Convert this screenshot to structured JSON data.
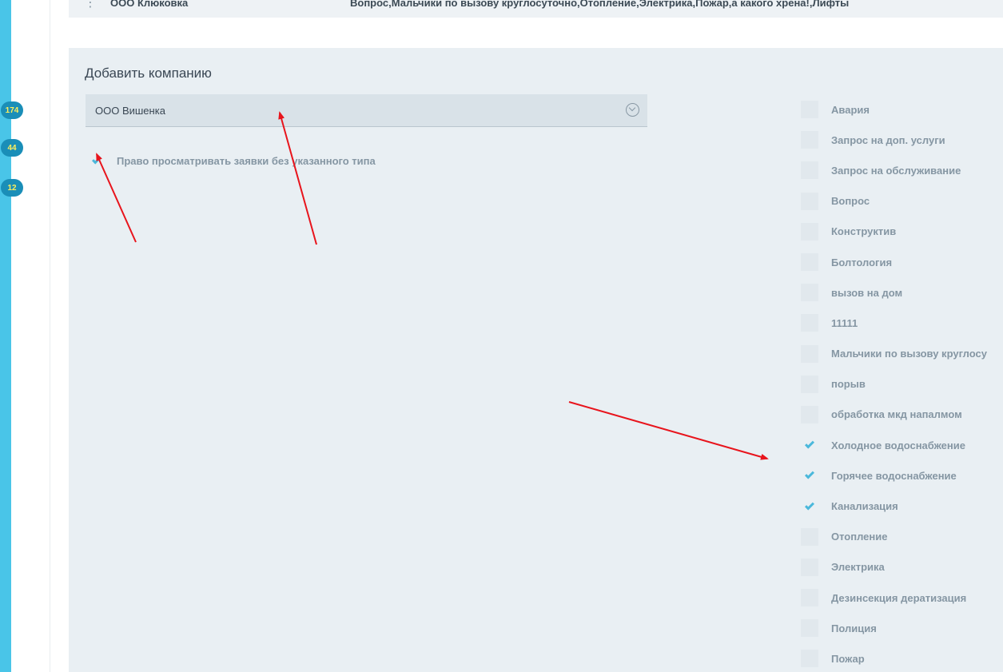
{
  "sidebar": {
    "badges": [
      "174",
      "44",
      "12"
    ],
    "accent_color": "#49c5e8",
    "badge_color": "#1a8eb8",
    "badge_text_color": "#ffef5c"
  },
  "table_row": {
    "company": "ООО Клюковка",
    "types": "Вопрос,Мальчики по вызову круглосуточно,Отопление,Электрика,Пожар,а какого хрена!,Лифты"
  },
  "add_company": {
    "title": "Добавить компанию",
    "select_value": "ООО Вишенка",
    "permission_label": "Право просматривать заявки без указанного типа",
    "permission_checked": true
  },
  "request_types": [
    {
      "label": "Авария",
      "checked": false
    },
    {
      "label": "Запрос на доп. услуги",
      "checked": false
    },
    {
      "label": "Запрос на обслуживание",
      "checked": false
    },
    {
      "label": "Вопрос",
      "checked": false
    },
    {
      "label": "Конструктив",
      "checked": false
    },
    {
      "label": "Болтология",
      "checked": false
    },
    {
      "label": "вызов на дом",
      "checked": false
    },
    {
      "label": "11111",
      "checked": false
    },
    {
      "label": "Мальчики по вызову круглосу",
      "checked": false
    },
    {
      "label": "порыв",
      "checked": false
    },
    {
      "label": "обработка мкд напалмом",
      "checked": false
    },
    {
      "label": "Холодное водоснабжение",
      "checked": true
    },
    {
      "label": "Горячее водоснабжение",
      "checked": true
    },
    {
      "label": "Канализация",
      "checked": true
    },
    {
      "label": "Отопление",
      "checked": false
    },
    {
      "label": "Электрика",
      "checked": false
    },
    {
      "label": "Дезинсекция дератизация",
      "checked": false
    },
    {
      "label": "Полиция",
      "checked": false
    },
    {
      "label": "Пожар",
      "checked": false
    }
  ],
  "annotation_color": "#e8141c"
}
